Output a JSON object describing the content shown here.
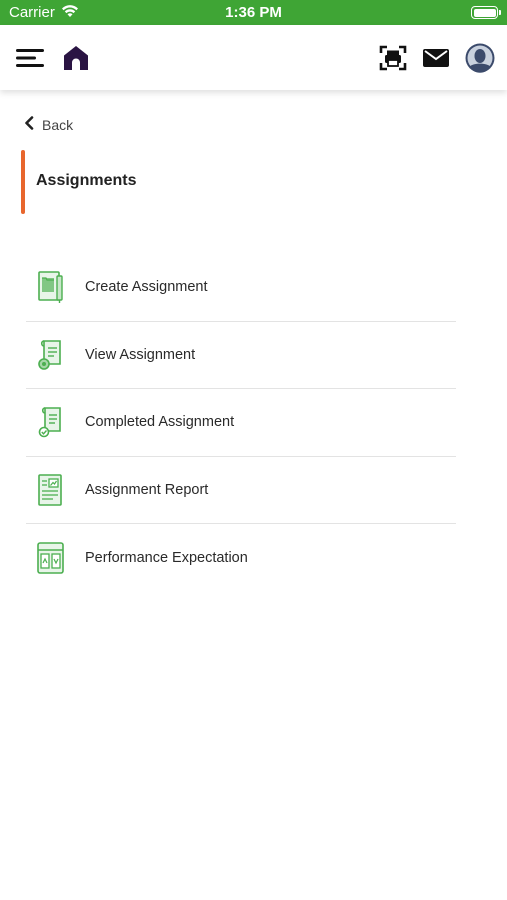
{
  "status_bar": {
    "carrier": "Carrier",
    "time": "1:36 PM",
    "bg_color": "#3fa535"
  },
  "header": {
    "icons": [
      "menu-icon",
      "home-icon",
      "scan-icon",
      "mail-icon",
      "profile-icon"
    ]
  },
  "back": {
    "label": "Back"
  },
  "page": {
    "title": "Assignments",
    "accent_color": "#e8662d"
  },
  "menu": {
    "icon_color": "#4caf50",
    "items": [
      {
        "label": "Create Assignment",
        "icon": "create-assignment-icon"
      },
      {
        "label": "View Assignment",
        "icon": "view-assignment-icon"
      },
      {
        "label": "Completed Assignment",
        "icon": "completed-assignment-icon"
      },
      {
        "label": "Assignment Report",
        "icon": "assignment-report-icon"
      },
      {
        "label": "Performance Expectation",
        "icon": "performance-expectation-icon"
      }
    ]
  }
}
